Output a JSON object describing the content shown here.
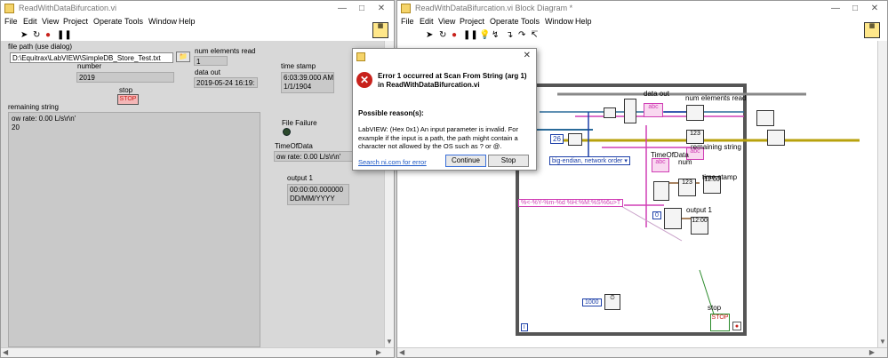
{
  "front_panel": {
    "title": "ReadWithDataBifurcation.vi",
    "menu": [
      "File",
      "Edit",
      "View",
      "Project",
      "Operate",
      "Tools",
      "Window",
      "Help"
    ],
    "file_path": {
      "label": "file path (use dialog)",
      "value": "D:\\Equitrax\\LabVIEW\\SimpleDB_Store_Test.txt"
    },
    "number": {
      "label": "number",
      "value": "2019"
    },
    "stop": {
      "label": "stop",
      "button": "STOP"
    },
    "num_elements": {
      "label": "num elements read",
      "value": "1"
    },
    "data_out": {
      "label": "data out",
      "value": "2019-05-24 16:19:"
    },
    "time_stamp": {
      "label": "time stamp",
      "time": "6:03:39.000 AM",
      "date": "1/1/1904"
    },
    "remaining_string": {
      "label": "remaining string",
      "line1": "ow rate: 0.00 L/s\\r\\n'",
      "line2": "20"
    },
    "file_failure": {
      "label": "File Failure"
    },
    "time_of_data": {
      "label": "TimeOfData",
      "value": "ow rate: 0.00 L/s\\r\\n'"
    },
    "output1": {
      "label": "output 1",
      "time": "00:00:00.000000",
      "date": "DD/MM/YYYY"
    }
  },
  "block_diagram": {
    "title": "ReadWithDataBifurcation.vi Block Diagram *",
    "menu": [
      "File",
      "Edit",
      "View",
      "Project",
      "Operate",
      "Tools",
      "Window",
      "Help"
    ],
    "labels": {
      "data_out": "data out",
      "num_elements_read": "num elements read",
      "remaining_string": "remaining string",
      "time_of_data": "TimeOfData",
      "num": "num",
      "time_stamp": "time stamp",
      "output_1": "output 1",
      "stop": "stop"
    },
    "constants": {
      "n26": "26",
      "endian": "big-endian, network order",
      "format": "%<-%Y-%m-%d %H:%M:%S%6u>T",
      "zero": "0",
      "wait_ms": "1000",
      "info": "i"
    },
    "terminal_text": {
      "abc": "abc",
      "i32": "123",
      "ts": "12:00",
      "stop": "STOP",
      "tf": "TF"
    }
  },
  "dialog": {
    "title_line": "Error 1 occurred at Scan From String (arg 1) in ReadWithDataBifurcation.vi",
    "reasons_heading": "Possible reason(s):",
    "message": "LabVIEW: (Hex 0x1) An input parameter is invalid. For example if the input is a path, the path might contain a character not allowed by the OS such as ? or @.",
    "link": "Search ni.com for error",
    "continue": "Continue",
    "stop": "Stop"
  },
  "colors": {
    "string_wire": "#d03fb5",
    "numeric_wire": "#1c3fa8",
    "bool_wire": "#2a8a2a",
    "error_red": "#c8221c",
    "stop_red": "#d8262d"
  }
}
